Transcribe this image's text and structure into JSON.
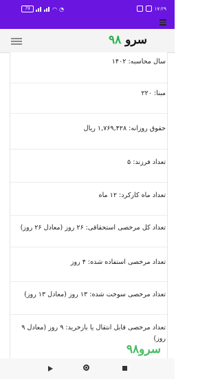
{
  "status_bar": {
    "time": "۱۷:۲۹",
    "battery": "79"
  },
  "header": {
    "logo_word": "سرو",
    "logo_number": "۹۸",
    "menu_icon": "hamburger-icon"
  },
  "rows": [
    "سال محاسبه: ۱۴۰۲",
    "مبنا: ۲۲۰",
    "حقوق روزانه: ۱,۷۶۹,۴۲۸ ریال",
    "تعداد فرزند: ۵",
    "تعداد ماه کارکرد: ۱۲ ماه",
    "تعداد کل مرخصی استحقاقی: ۲۶ روز (معادل ۲۶ روز)",
    "تعداد مرخصی استفاده شده: ۴ روز",
    "تعداد مرخصی سوخت شده: ۱۳ روز (معادل ۱۳ روز)",
    "تعداد مرخصی قابل انتقال یا بازخرید: ۹ روز (معادل ۹ روز)"
  ],
  "watermark": "سرو۹۸",
  "colors": {
    "accent": "#6a16e0",
    "brand_green": "#29b14a"
  }
}
